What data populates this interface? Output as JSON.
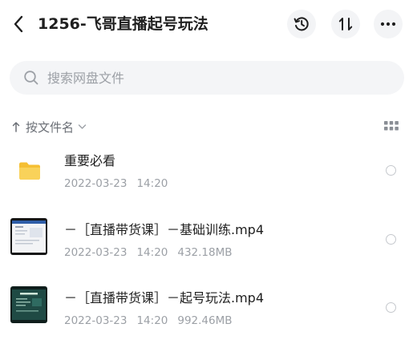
{
  "header": {
    "title": "1256-飞哥直播起号玩法"
  },
  "search": {
    "placeholder": "搜索网盘文件"
  },
  "sort": {
    "label": "按文件名"
  },
  "files": [
    {
      "name": "重要必看",
      "date": "2022-03-23",
      "time": "14:20",
      "size": "",
      "type": "folder"
    },
    {
      "name": "－［直播带货课］－基础训练.mp4",
      "date": "2022-03-23",
      "time": "14:20",
      "size": "432.18MB",
      "type": "video"
    },
    {
      "name": "－［直播带货课］－起号玩法.mp4",
      "date": "2022-03-23",
      "time": "14:20",
      "size": "992.46MB",
      "type": "video"
    }
  ],
  "colors": {
    "folder": "#f7c844",
    "button_bg": "#f3f4f6",
    "search_bg": "#f4f5f7",
    "muted_text": "#9ca0a6"
  }
}
